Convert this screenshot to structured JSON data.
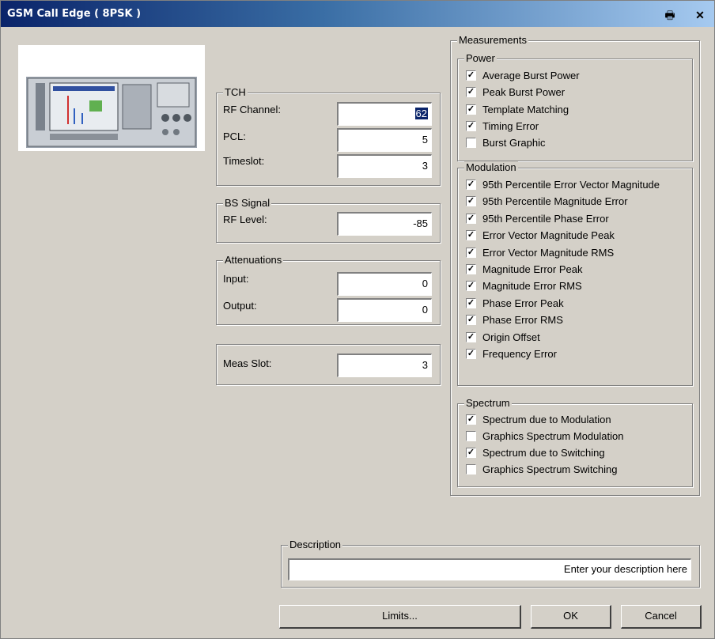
{
  "window": {
    "title": "GSM Call Edge ( 8PSK )"
  },
  "icons": {
    "print": "printer-icon",
    "close": "close-icon"
  },
  "tch": {
    "legend": "TCH",
    "rf_channel_label": "RF Channel:",
    "rf_channel_value": "62",
    "pcl_label": "PCL:",
    "pcl_value": "5",
    "timeslot_label": "Timeslot:",
    "timeslot_value": "3"
  },
  "bs_signal": {
    "legend": "BS Signal",
    "rf_level_label": "RF Level:",
    "rf_level_value": "-85"
  },
  "attenuations": {
    "legend": "Attenuations",
    "input_label": "Input:",
    "input_value": "0",
    "output_label": "Output:",
    "output_value": "0"
  },
  "meas_slot": {
    "label": "Meas Slot:",
    "value": "3"
  },
  "measurements": {
    "legend": "Measurements",
    "power": {
      "legend": "Power",
      "items": [
        {
          "label": "Average Burst Power",
          "checked": true
        },
        {
          "label": "Peak Burst Power",
          "checked": true
        },
        {
          "label": "Template Matching",
          "checked": true
        },
        {
          "label": "Timing Error",
          "checked": true
        },
        {
          "label": "Burst Graphic",
          "checked": false
        }
      ]
    },
    "modulation": {
      "legend": "Modulation",
      "items": [
        {
          "label": "95th Percentile Error Vector Magnitude",
          "checked": true
        },
        {
          "label": "95th Percentile Magnitude Error",
          "checked": true
        },
        {
          "label": "95th Percentile Phase Error",
          "checked": true
        },
        {
          "label": "Error Vector Magnitude Peak",
          "checked": true
        },
        {
          "label": "Error Vector Magnitude RMS",
          "checked": true
        },
        {
          "label": "Magnitude Error Peak",
          "checked": true
        },
        {
          "label": "Magnitude Error RMS",
          "checked": true
        },
        {
          "label": "Phase Error Peak",
          "checked": true
        },
        {
          "label": "Phase Error RMS",
          "checked": true
        },
        {
          "label": "Origin Offset",
          "checked": true
        },
        {
          "label": "Frequency Error",
          "checked": true
        }
      ]
    },
    "spectrum": {
      "legend": "Spectrum",
      "items": [
        {
          "label": "Spectrum due to Modulation",
          "checked": true
        },
        {
          "label": "Graphics Spectrum Modulation",
          "checked": false
        },
        {
          "label": "Spectrum due to Switching",
          "checked": true
        },
        {
          "label": "Graphics Spectrum Switching",
          "checked": false
        }
      ]
    }
  },
  "description": {
    "legend": "Description",
    "value": "Enter your description here"
  },
  "buttons": {
    "limits": "Limits...",
    "ok": "OK",
    "cancel": "Cancel"
  }
}
